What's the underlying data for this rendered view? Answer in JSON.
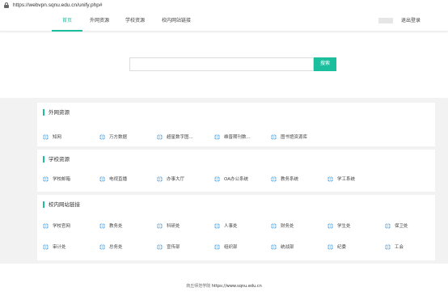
{
  "browser": {
    "url": "https://webvpn.sqnu.edu.cn/unify.php#"
  },
  "nav": {
    "tabs": [
      "首页",
      "外网资源",
      "学校资源",
      "校内网站链接"
    ],
    "logout": "退出登录"
  },
  "search": {
    "placeholder": "",
    "button": "搜索"
  },
  "sections": [
    {
      "title": "外网资源",
      "items": [
        "知网",
        "万方数据",
        "超星数字图...",
        "维普期刊数...",
        "图书馆资源库"
      ]
    },
    {
      "title": "学校资源",
      "items": [
        "学校邮箱",
        "电视直播",
        "办事大厅",
        "OA办公系统",
        "教务系统",
        "学工系统"
      ]
    },
    {
      "title": "校内网站链接",
      "items": [
        "学校官网",
        "教务处",
        "科研处",
        "人事处",
        "财务处",
        "学生处",
        "保卫处",
        "审计处",
        "总务处",
        "宣传部",
        "组织部",
        "统战部",
        "纪委",
        "工会"
      ]
    }
  ],
  "footer": {
    "label": "商丘师范学院",
    "website": "https://www.sqnu.edu.cn"
  },
  "colors": {
    "accent": "#1bbf9e",
    "icon": "#7fb7e6",
    "background": "#f2f2f2"
  },
  "icons": {
    "lock": "lock-icon",
    "item": "globe-icon"
  }
}
